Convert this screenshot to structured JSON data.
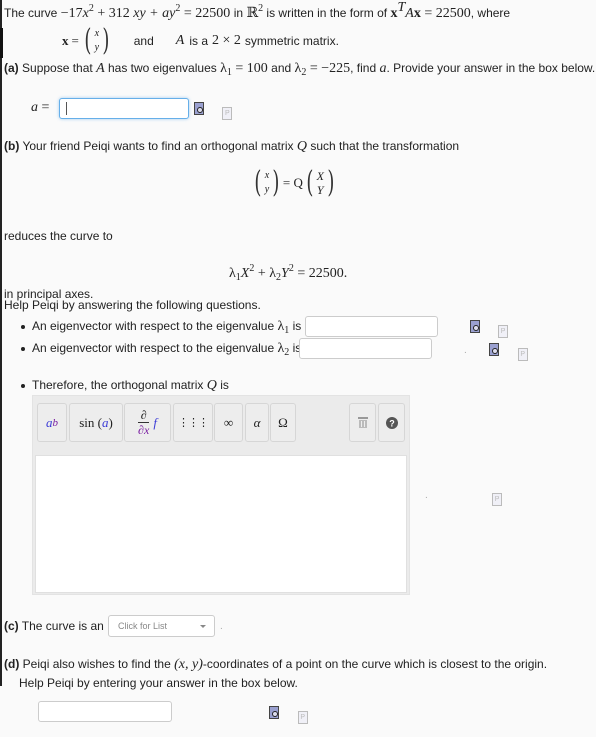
{
  "intro": {
    "text_the_curve": "The curve",
    "equation_coeff_x2": "−17",
    "equation_coeff_xy": "+ 312",
    "equation_coeff_y2": "+ a",
    "equation_rhs": "= 22500",
    "in_r2": "in",
    "r_symbol": "ℝ",
    "written_form": "is written in the form of",
    "form_rhs": "= 22500",
    "where": ", where",
    "x_bold": "x",
    "x_equals": "x =",
    "vec_top": "x",
    "vec_bottom": "y",
    "and": "and",
    "A": "A",
    "is_a": "is a",
    "dims": "2 × 2",
    "symmetric": "symmetric matrix."
  },
  "part_a": {
    "label": "(a)",
    "text1": "Suppose that",
    "A": "A",
    "text2": "has two eigenvalues",
    "lambda1_val": "= 100",
    "and": "and",
    "lambda2_val": "= −225",
    "text3": ", find",
    "a": "a",
    "text4": ". Provide your answer in the box below.",
    "answer_label": "a =",
    "answer_value": ""
  },
  "part_b": {
    "label": "(b)",
    "text1": "Your friend Peiqi wants to find an orthogonal matrix",
    "Q": "Q",
    "text2": "such that the transformation",
    "lhs_top": "x",
    "lhs_bottom": "y",
    "eq_Q": "= Q",
    "rhs_top": "X",
    "rhs_bottom": "Y",
    "reduces": "reduces the curve to",
    "reduced_rhs": "= 22500.",
    "principal": "in principal axes.",
    "help": "Help Peiqi by answering the following questions.",
    "bullet1": "An eigenvector with respect to the eigenvalue",
    "bullet1_is": "is",
    "bullet2": "An eigenvector with respect to the eigenvalue",
    "bullet2_is": "is",
    "bullet3": "Therefore, the orthogonal matrix",
    "bullet3_Q": "Q",
    "bullet3_is": "is",
    "eigvec1_value": "",
    "eigvec2_value": "",
    "matrix_value": "",
    "toolbar": {
      "power_base": "a",
      "power_exp": "b",
      "sin": "sin",
      "sin_arg": "a",
      "partial_top": "∂",
      "partial_bottom": "∂x",
      "partial_f": "f",
      "matrix": "⋮⋮⋮",
      "infinity": "∞",
      "alpha": "α",
      "omega": "Ω"
    }
  },
  "part_c": {
    "label": "(c)",
    "text": "The curve is an",
    "select_placeholder": "Click for List",
    "trailing": "."
  },
  "part_d": {
    "label": "(d)",
    "text1": "Peiqi also wishes to find the",
    "coords": "(x, y)",
    "text2": "-coordinates of a point on the curve which is closest to the origin.",
    "text3": "Help Peiqi by entering your answer in the box below.",
    "answer_value": ""
  },
  "colors": {
    "focus_blue": "#66afe9",
    "math_blue": "#3b3bd6",
    "math_purple": "#7a1fa2"
  }
}
